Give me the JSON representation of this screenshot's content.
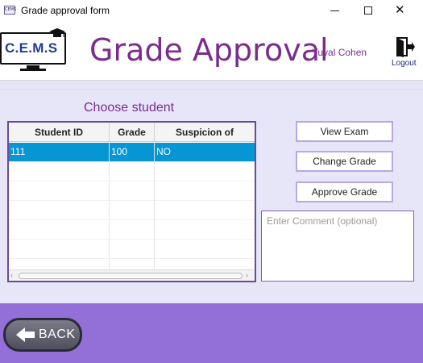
{
  "window": {
    "title": "Grade approval form",
    "icon_text": "CEMS",
    "controls": {
      "minimize": "–",
      "maximize": "☐",
      "close": "✕"
    }
  },
  "header": {
    "logo_text": "C.E.M.S",
    "title": "Grade Approval",
    "user_name": "Yuval Cohen",
    "logout_label": "Logout"
  },
  "main": {
    "choose_label": "Choose student",
    "table": {
      "columns": [
        "Student ID",
        "Grade",
        "Suspicion of cheating"
      ],
      "rows": [
        {
          "student_id": "111",
          "grade": "100",
          "suspicion": "NO",
          "selected": true
        }
      ],
      "empty_row_count": 6
    },
    "buttons": {
      "view_exam": "View Exam",
      "change_grade": "Change Grade",
      "approve_grade": "Approve Grade"
    },
    "comment": {
      "placeholder": "Enter Comment (optional)",
      "value": ""
    }
  },
  "footer": {
    "back_label": "BACK"
  },
  "colors": {
    "accent_purple": "#7a2d8e",
    "footer_purple": "#9370d8",
    "selected_row": "#0596d3",
    "content_bg": "#e6e6f8"
  }
}
